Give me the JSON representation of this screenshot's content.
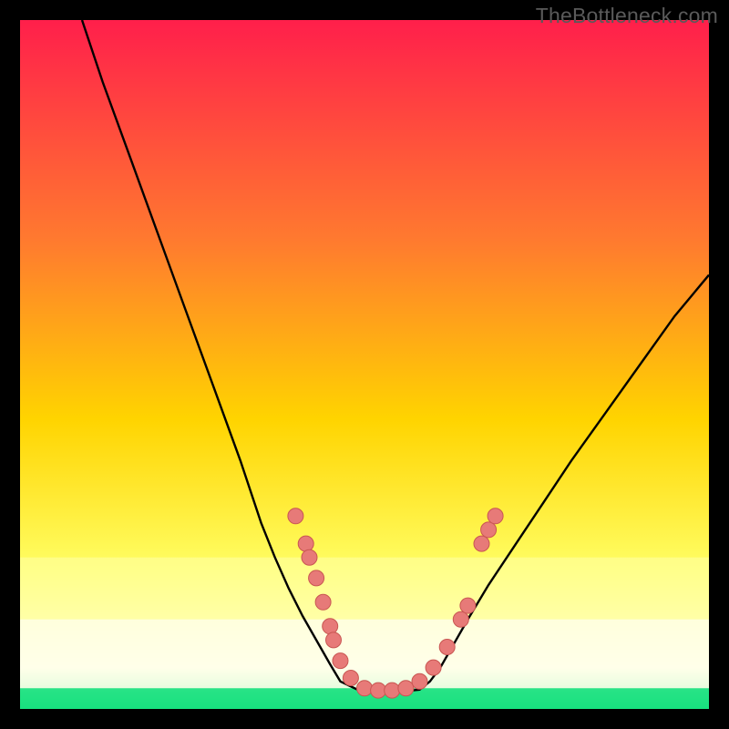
{
  "watermark": "TheBottleneck.com",
  "colors": {
    "gradient_top": "#ff1f4b",
    "gradient_mid1": "#ff7a2f",
    "gradient_mid2": "#ffd400",
    "gradient_low1": "#ffff66",
    "gradient_low2": "#fdffe0",
    "gradient_bottom": "#18e07f",
    "curve": "#000000",
    "marker_fill": "#e77a78",
    "marker_stroke": "#c95652"
  },
  "chart_data": {
    "type": "line",
    "title": "",
    "xlabel": "",
    "ylabel": "",
    "xlim": [
      0,
      100
    ],
    "ylim": [
      0,
      100
    ],
    "series": [
      {
        "name": "left-curve",
        "x": [
          9,
          12,
          16,
          20,
          24,
          28,
          32,
          35,
          37,
          39,
          41,
          43,
          45,
          46.5
        ],
        "y": [
          100,
          91,
          80,
          69,
          58,
          47,
          36,
          27,
          22,
          17.5,
          13.5,
          10,
          6.5,
          4
        ]
      },
      {
        "name": "valley",
        "x": [
          46.5,
          49,
          52,
          55,
          58,
          59.5
        ],
        "y": [
          4,
          2.8,
          2.5,
          2.5,
          2.8,
          4
        ]
      },
      {
        "name": "right-curve",
        "x": [
          59.5,
          61,
          63,
          65,
          68,
          72,
          76,
          80,
          85,
          90,
          95,
          100
        ],
        "y": [
          4,
          6,
          9.5,
          13,
          18,
          24,
          30,
          36,
          43,
          50,
          57,
          63
        ]
      }
    ],
    "markers": [
      {
        "x": 40,
        "y": 28
      },
      {
        "x": 41.5,
        "y": 24
      },
      {
        "x": 42,
        "y": 22
      },
      {
        "x": 43,
        "y": 19
      },
      {
        "x": 44,
        "y": 15.5
      },
      {
        "x": 45,
        "y": 12
      },
      {
        "x": 45.5,
        "y": 10
      },
      {
        "x": 46.5,
        "y": 7
      },
      {
        "x": 48,
        "y": 4.5
      },
      {
        "x": 50,
        "y": 3
      },
      {
        "x": 52,
        "y": 2.7
      },
      {
        "x": 54,
        "y": 2.7
      },
      {
        "x": 56,
        "y": 3
      },
      {
        "x": 58,
        "y": 4
      },
      {
        "x": 60,
        "y": 6
      },
      {
        "x": 62,
        "y": 9
      },
      {
        "x": 64,
        "y": 13
      },
      {
        "x": 65,
        "y": 15
      },
      {
        "x": 67,
        "y": 24
      },
      {
        "x": 68,
        "y": 26
      },
      {
        "x": 69,
        "y": 28
      }
    ],
    "bands": [
      {
        "name": "pale-yellow-band",
        "y_from": 22,
        "y_to": 13
      },
      {
        "name": "cream-band",
        "y_from": 13,
        "y_to": 3
      },
      {
        "name": "green-band",
        "y_from": 3,
        "y_to": 0
      }
    ]
  }
}
